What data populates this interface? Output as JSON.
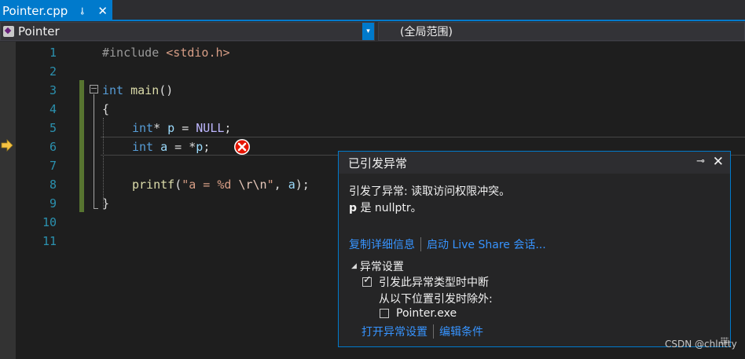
{
  "tab": {
    "title": "Pointer.cpp",
    "pin": "⊸",
    "close": "✕"
  },
  "navbar": {
    "left": "Pointer",
    "right": "(全局范围)",
    "dropdown": "▾"
  },
  "line_numbers": [
    "1",
    "2",
    "3",
    "4",
    "5",
    "6",
    "7",
    "8",
    "9",
    "10",
    "11"
  ],
  "code": {
    "l1": {
      "pp": "#include ",
      "hdr": "<stdio.h>"
    },
    "l3": {
      "kw": "int",
      "fn": " main",
      "rest": "()"
    },
    "l4": {
      "text": "{"
    },
    "l5": {
      "kw": "int",
      "star": "* ",
      "var": "p",
      "eq": " = ",
      "macro": "NULL",
      "end": ";"
    },
    "l6": {
      "kw": "int",
      "sp": " ",
      "var": "a",
      "mid": " = *",
      "var2": "p",
      "end": ";"
    },
    "l8": {
      "fn": "printf",
      "open": "(",
      "s1": "\"a = %d ",
      "e1": "\\r\\n",
      "s2": "\"",
      "comma": ", ",
      "var": "a",
      "end": ");"
    },
    "l9": {
      "text": "}"
    }
  },
  "collapse_glyph": "−",
  "exception": {
    "title": "已引发异常",
    "pin": "⊸",
    "close": "✕",
    "message_line1": "引发了异常: 读取访问权限冲突。",
    "message_var": "p",
    "message_line2_rest": " 是 nullptr。",
    "link_copy": "复制详细信息",
    "link_liveshare": "启动 Live Share 会话...",
    "settings_title": "异常设置",
    "settings_triangle": "◢",
    "break_label": "引发此异常类型时中断",
    "except_label": "从以下位置引发时除外:",
    "module_label": "Pointer.exe",
    "link_open_settings": "打开异常设置",
    "link_edit_conditions": "编辑条件"
  },
  "watermark": "CSDN @chlntty",
  "colors": {
    "accent": "#007acc",
    "line_number": "#2b91af",
    "keyword": "#569cd6",
    "link": "#3794ff",
    "change_bar": "#577430"
  }
}
